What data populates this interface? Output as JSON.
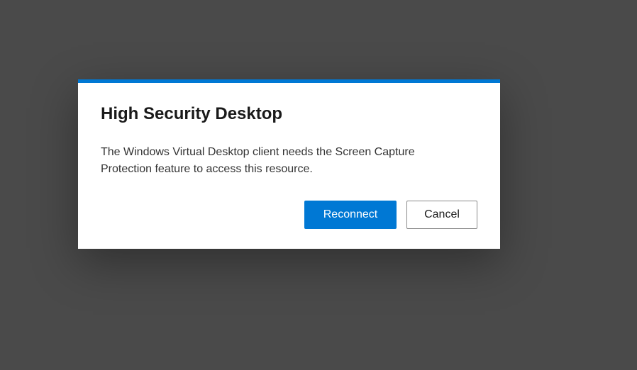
{
  "dialog": {
    "title": "High Security Desktop",
    "message": "The Windows Virtual Desktop client needs the Screen Capture Protection feature to access this resource.",
    "accent_color": "#0078d4",
    "actions": {
      "primary_label": "Reconnect",
      "secondary_label": "Cancel"
    }
  }
}
